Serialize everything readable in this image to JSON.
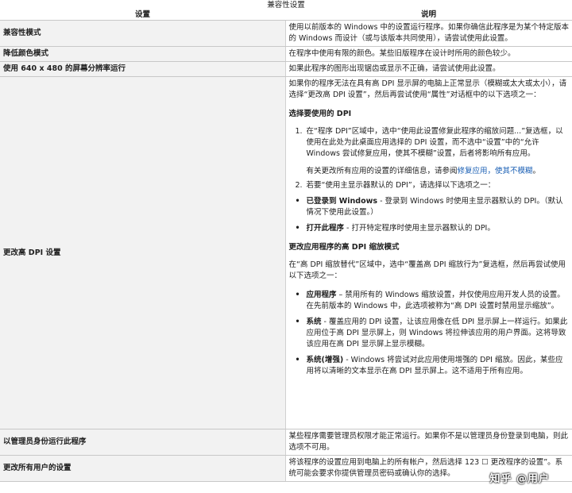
{
  "caption": "兼容性设置",
  "headers": {
    "setting": "设置",
    "description": "说明"
  },
  "rows": [
    {
      "setting": "兼容性模式",
      "desc": "使用以前版本的 Windows 中的设置运行程序。如果你确信此程序是为某个特定版本的 Windows 而设计（或与该版本共同使用），请尝试使用此设置。"
    },
    {
      "setting": "降低颜色模式",
      "desc": "在程序中使用有限的颜色。某些旧版程序在设计时所用的颜色较少。"
    },
    {
      "setting": "使用 640 x 480 的屏幕分辨率运行",
      "desc": "如果此程序的图形出现锯齿或显示不正确，请尝试使用此设置。"
    },
    {
      "setting": "更改高 DPI 设置"
    },
    {
      "setting": "以管理员身份运行此程序",
      "desc": "某些程序需要管理员权限才能正常运行。如果你不是以管理员身份登录到电脑，则此选项不可用。"
    },
    {
      "setting": "更改所有用户的设置",
      "desc": "将该程序的设置应用到电脑上的所有帐户，然后选择 123 ☐ 更改程序的设置”。系统可能会要求你提供管理员密码或确认你的选择。"
    }
  ],
  "dpi": {
    "intro": "如果你的程序无法在具有高 DPI 显示屏的电脑上正常显示（模糊或太大或太小），请选择“更改高 DPI 设置”，然后再尝试使用“属性”对话框中的以下选项之一：",
    "choose_heading": "选择要使用的 DPI",
    "step1_num": "1.",
    "step1": "在“程序 DPI”区域中，选中“使用此设置修复此程序的缩放问题...”复选框，以使用在此处为此桌面应用选择的 DPI 设置，而不选中“设置”中的“允许 Windows 尝试修复应用，使其不模糊”设置，后者将影响所有应用。",
    "note_prefix": "有关更改所有应用的设置的详细信息，请参阅",
    "note_link": "修复应用，使其不模糊",
    "note_suffix": "。",
    "step2_num": "2.",
    "step2": "若要“使用主显示器默认的 DPI”，请选择以下选项之一：",
    "b1_title": "已登录到 Windows",
    "b1_text": " - 登录到 Windows 时使用主显示器默认的 DPI。（默认情况下使用此设置。）",
    "b2_title": "打开此程序",
    "b2_text": " - 打开特定程序时使用主显示器默认的 DPI。",
    "mode_heading": "更改应用程序的高 DPI 缩放模式",
    "mode_intro": "在“高 DPI 缩放替代”区域中，选中“覆盖高 DPI 缩放行为”复选框，然后再尝试使用以下选项之一：",
    "m1_title": "应用程序",
    "m1_text": " – 禁用所有的 Windows 缩放设置，并仅使用应用开发人员的设置。在先前版本的 Windows 中，此选项被称为“高 DPI 设置时禁用显示缩放”。",
    "m2_title": "系统",
    "m2_text": " - 覆盖应用的 DPI 设置，让该应用像在低 DPI 显示屏上一样运行。如果此应用位于高 DPI 显示屏上，则 Windows 将拉伸该应用的用户界面。这将导致该应用在高 DPI 显示屏上显示模糊。",
    "m3_title": "系统(增强)",
    "m3_text": " - Windows 将尝试对此应用使用增强的 DPI 缩放。因此，某些应用将以清晰的文本显示在高 DPI 显示屏上。这不适用于所有应用。",
    "bullet": "•"
  },
  "watermark": "知乎 @用户"
}
